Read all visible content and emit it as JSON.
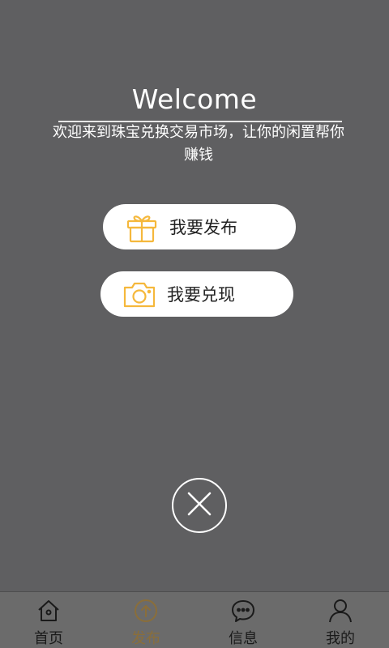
{
  "popup": {
    "welcome": "Welcome",
    "subtitle": "欢迎来到珠宝兑换交易市场，让你的闲置帮你赚钱",
    "publish_label": "我要发布",
    "cash_label": "我要兑现",
    "icons": {
      "publish": "gift-icon",
      "cash": "camera-icon",
      "close": "close-icon"
    },
    "accent_color": "#f5b83c"
  },
  "tabbar": {
    "items": [
      {
        "label": "首页",
        "icon": "home-icon",
        "active": false
      },
      {
        "label": "发布",
        "icon": "arrow-up-circle-icon",
        "active": true
      },
      {
        "label": "信息",
        "icon": "chat-bubble-icon",
        "active": false
      },
      {
        "label": "我的",
        "icon": "user-icon",
        "active": false
      }
    ]
  }
}
